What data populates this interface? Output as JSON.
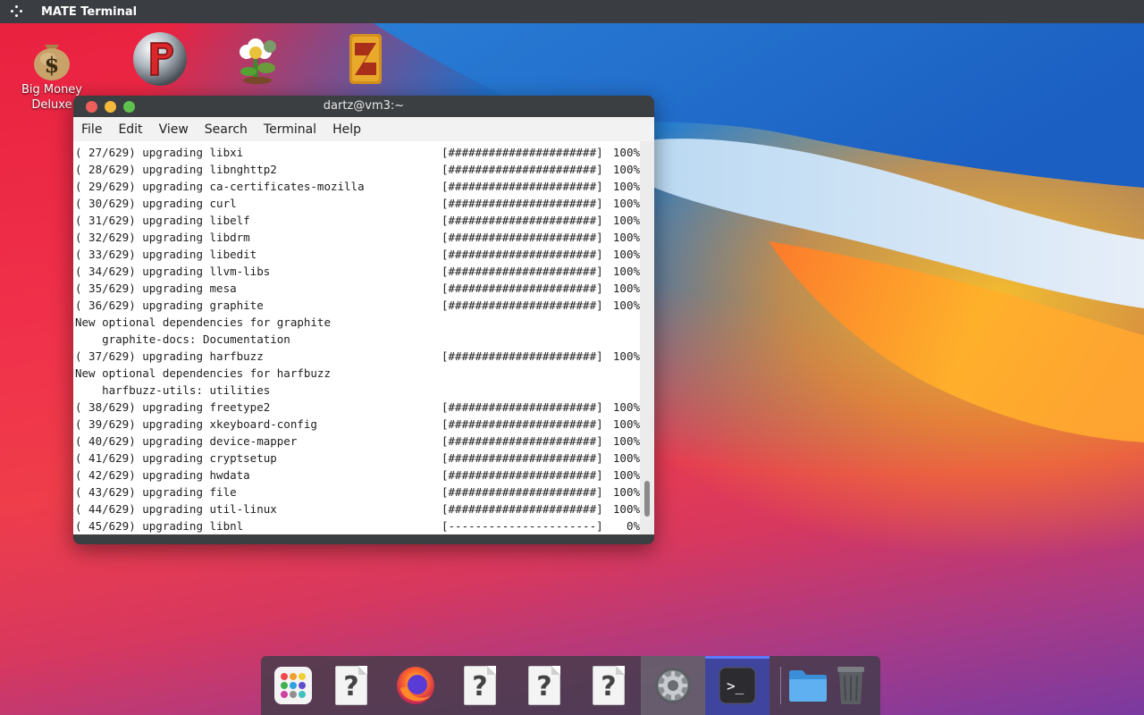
{
  "top_panel": {
    "app_title": "MATE Terminal"
  },
  "desktop_icons": [
    {
      "label_line1": "Big Money",
      "label_line2": "Deluxe",
      "icon": "money-bag-icon"
    },
    {
      "label_line1": "",
      "label_line2": "",
      "icon": "peggle-ball-icon"
    },
    {
      "label_line1": "",
      "label_line2": "",
      "icon": "plants-vs-zombies-icon"
    },
    {
      "label_line1": "",
      "label_line2": "",
      "icon": "zuma-icon"
    }
  ],
  "terminal": {
    "title": "dartz@vm3:~",
    "menu": [
      "File",
      "Edit",
      "View",
      "Search",
      "Terminal",
      "Help"
    ],
    "lines": [
      {
        "text": "( 27/629) upgrading libxi",
        "bar": "[######################]",
        "pct": "100%"
      },
      {
        "text": "( 28/629) upgrading libnghttp2",
        "bar": "[######################]",
        "pct": "100%"
      },
      {
        "text": "( 29/629) upgrading ca-certificates-mozilla",
        "bar": "[######################]",
        "pct": "100%"
      },
      {
        "text": "( 30/629) upgrading curl",
        "bar": "[######################]",
        "pct": "100%"
      },
      {
        "text": "( 31/629) upgrading libelf",
        "bar": "[######################]",
        "pct": "100%"
      },
      {
        "text": "( 32/629) upgrading libdrm",
        "bar": "[######################]",
        "pct": "100%"
      },
      {
        "text": "( 33/629) upgrading libedit",
        "bar": "[######################]",
        "pct": "100%"
      },
      {
        "text": "( 34/629) upgrading llvm-libs",
        "bar": "[######################]",
        "pct": "100%"
      },
      {
        "text": "( 35/629) upgrading mesa",
        "bar": "[######################]",
        "pct": "100%"
      },
      {
        "text": "( 36/629) upgrading graphite",
        "bar": "[######################]",
        "pct": "100%"
      },
      {
        "text": "New optional dependencies for graphite",
        "bar": "",
        "pct": ""
      },
      {
        "text": "    graphite-docs: Documentation",
        "bar": "",
        "pct": ""
      },
      {
        "text": "( 37/629) upgrading harfbuzz",
        "bar": "[######################]",
        "pct": "100%"
      },
      {
        "text": "New optional dependencies for harfbuzz",
        "bar": "",
        "pct": ""
      },
      {
        "text": "    harfbuzz-utils: utilities",
        "bar": "",
        "pct": ""
      },
      {
        "text": "( 38/629) upgrading freetype2",
        "bar": "[######################]",
        "pct": "100%"
      },
      {
        "text": "( 39/629) upgrading xkeyboard-config",
        "bar": "[######################]",
        "pct": "100%"
      },
      {
        "text": "( 40/629) upgrading device-mapper",
        "bar": "[######################]",
        "pct": "100%"
      },
      {
        "text": "( 41/629) upgrading cryptsetup",
        "bar": "[######################]",
        "pct": "100%"
      },
      {
        "text": "( 42/629) upgrading hwdata",
        "bar": "[######################]",
        "pct": "100%"
      },
      {
        "text": "( 43/629) upgrading file",
        "bar": "[######################]",
        "pct": "100%"
      },
      {
        "text": "( 44/629) upgrading util-linux",
        "bar": "[######################]",
        "pct": "100%"
      },
      {
        "text": "( 45/629) upgrading libnl",
        "bar": "[----------------------]",
        "pct": "0%"
      }
    ],
    "scroll_position": 0.96
  },
  "dock": {
    "items": [
      {
        "icon": "app-grid-icon",
        "state": "normal"
      },
      {
        "icon": "unknown-file-icon",
        "state": "normal"
      },
      {
        "icon": "firefox-icon",
        "state": "normal"
      },
      {
        "icon": "unknown-file-icon",
        "state": "normal"
      },
      {
        "icon": "unknown-file-icon",
        "state": "normal"
      },
      {
        "icon": "unknown-file-icon",
        "state": "normal"
      },
      {
        "icon": "settings-gear-icon",
        "state": "active"
      },
      {
        "icon": "terminal-icon",
        "state": "running"
      },
      {
        "icon": "folder-icon",
        "state": "normal"
      },
      {
        "icon": "trash-icon",
        "state": "normal"
      }
    ],
    "terminal_prompt_glyph": ">_",
    "unknown_glyph": "?"
  },
  "colors": {
    "panel_bg": "#3a3d42",
    "titlebar_bg": "#3c3f41",
    "close": "#ee5f5b",
    "minimize": "#f5b93b",
    "maximize": "#5fc24e",
    "dock_running": "#3c46aa"
  }
}
